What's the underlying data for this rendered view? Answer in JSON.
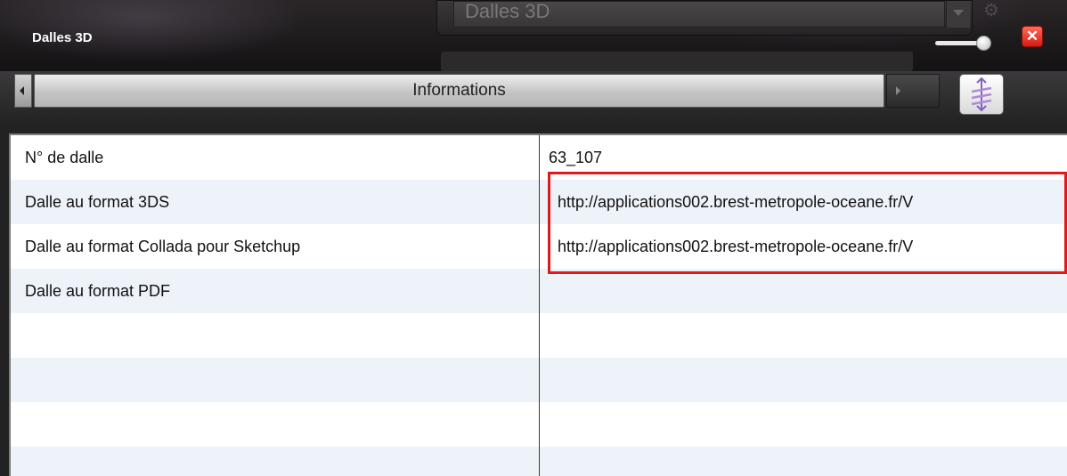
{
  "window": {
    "title": "Dalles 3D",
    "background_combo_text": "Dalles 3D",
    "close_label": "✕",
    "gear_glyph": "⚙"
  },
  "tabs": {
    "active_label": "Informations",
    "pin_icon": "pin-icon"
  },
  "table": {
    "rows": [
      {
        "key": "N° de dalle",
        "value": "63_107"
      },
      {
        "key": "Dalle au format 3DS",
        "value": "http://applications002.brest-metropole-oceane.fr/V"
      },
      {
        "key": "Dalle au format Collada pour Sketchup",
        "value": "http://applications002.brest-metropole-oceane.fr/V"
      },
      {
        "key": "Dalle au format PDF",
        "value": ""
      },
      {
        "key": "",
        "value": ""
      },
      {
        "key": "",
        "value": ""
      },
      {
        "key": "",
        "value": ""
      },
      {
        "key": "",
        "value": ""
      }
    ]
  },
  "colors": {
    "highlight": "#e01a1a",
    "row_alt": "#eef3f9",
    "close": "#e0261a"
  }
}
